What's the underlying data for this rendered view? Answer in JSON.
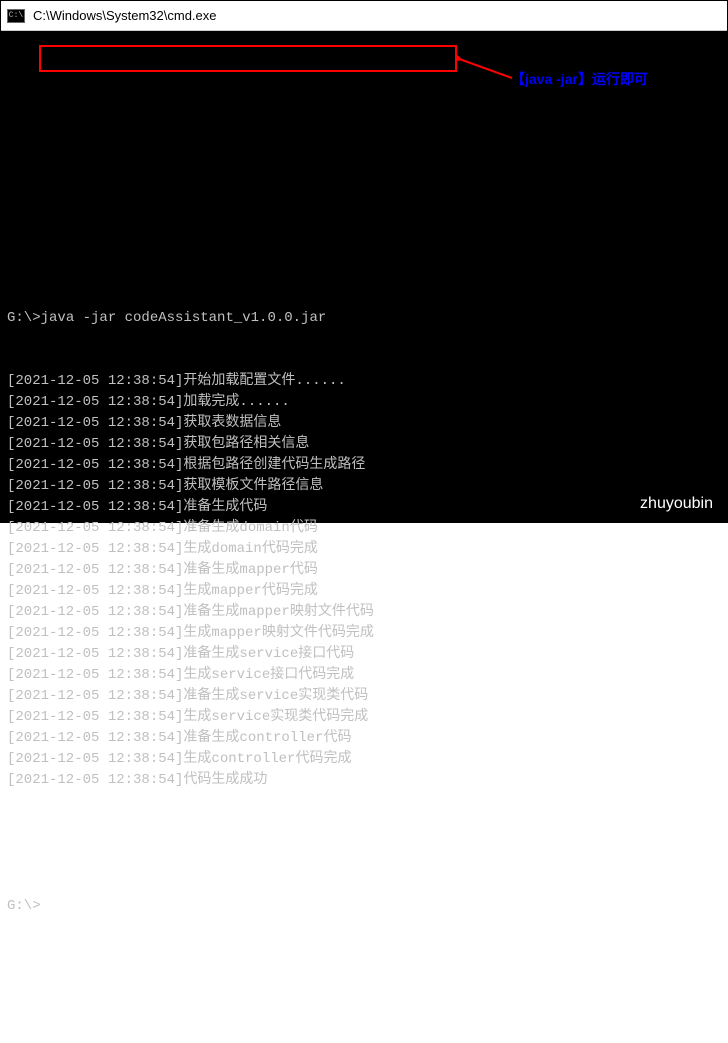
{
  "window": {
    "title": "C:\\Windows\\System32\\cmd.exe",
    "icon_label": "cmd"
  },
  "terminal": {
    "prompt": "G:\\>",
    "command": "java -jar codeAssistant_v1.0.0.jar",
    "final_prompt": "G:\\>",
    "logs": [
      "[2021-12-05 12:38:54]开始加载配置文件......",
      "[2021-12-05 12:38:54]加载完成......",
      "[2021-12-05 12:38:54]获取表数据信息",
      "[2021-12-05 12:38:54]获取包路径相关信息",
      "[2021-12-05 12:38:54]根据包路径创建代码生成路径",
      "[2021-12-05 12:38:54]获取模板文件路径信息",
      "[2021-12-05 12:38:54]准备生成代码",
      "[2021-12-05 12:38:54]准备生成domain代码",
      "[2021-12-05 12:38:54]生成domain代码完成",
      "[2021-12-05 12:38:54]准备生成mapper代码",
      "[2021-12-05 12:38:54]生成mapper代码完成",
      "[2021-12-05 12:38:54]准备生成mapper映射文件代码",
      "[2021-12-05 12:38:54]生成mapper映射文件代码完成",
      "[2021-12-05 12:38:54]准备生成service接口代码",
      "[2021-12-05 12:38:54]生成service接口代码完成",
      "[2021-12-05 12:38:54]准备生成service实现类代码",
      "[2021-12-05 12:38:54]生成service实现类代码完成",
      "[2021-12-05 12:38:54]准备生成controller代码",
      "[2021-12-05 12:38:54]生成controller代码完成",
      "[2021-12-05 12:38:54]代码生成成功"
    ]
  },
  "annotation": {
    "bracket_open": "【",
    "annotated_cmd": "java -jar",
    "bracket_close": "】",
    "hint_text": "运行即可"
  },
  "watermark": "zhuyoubin"
}
